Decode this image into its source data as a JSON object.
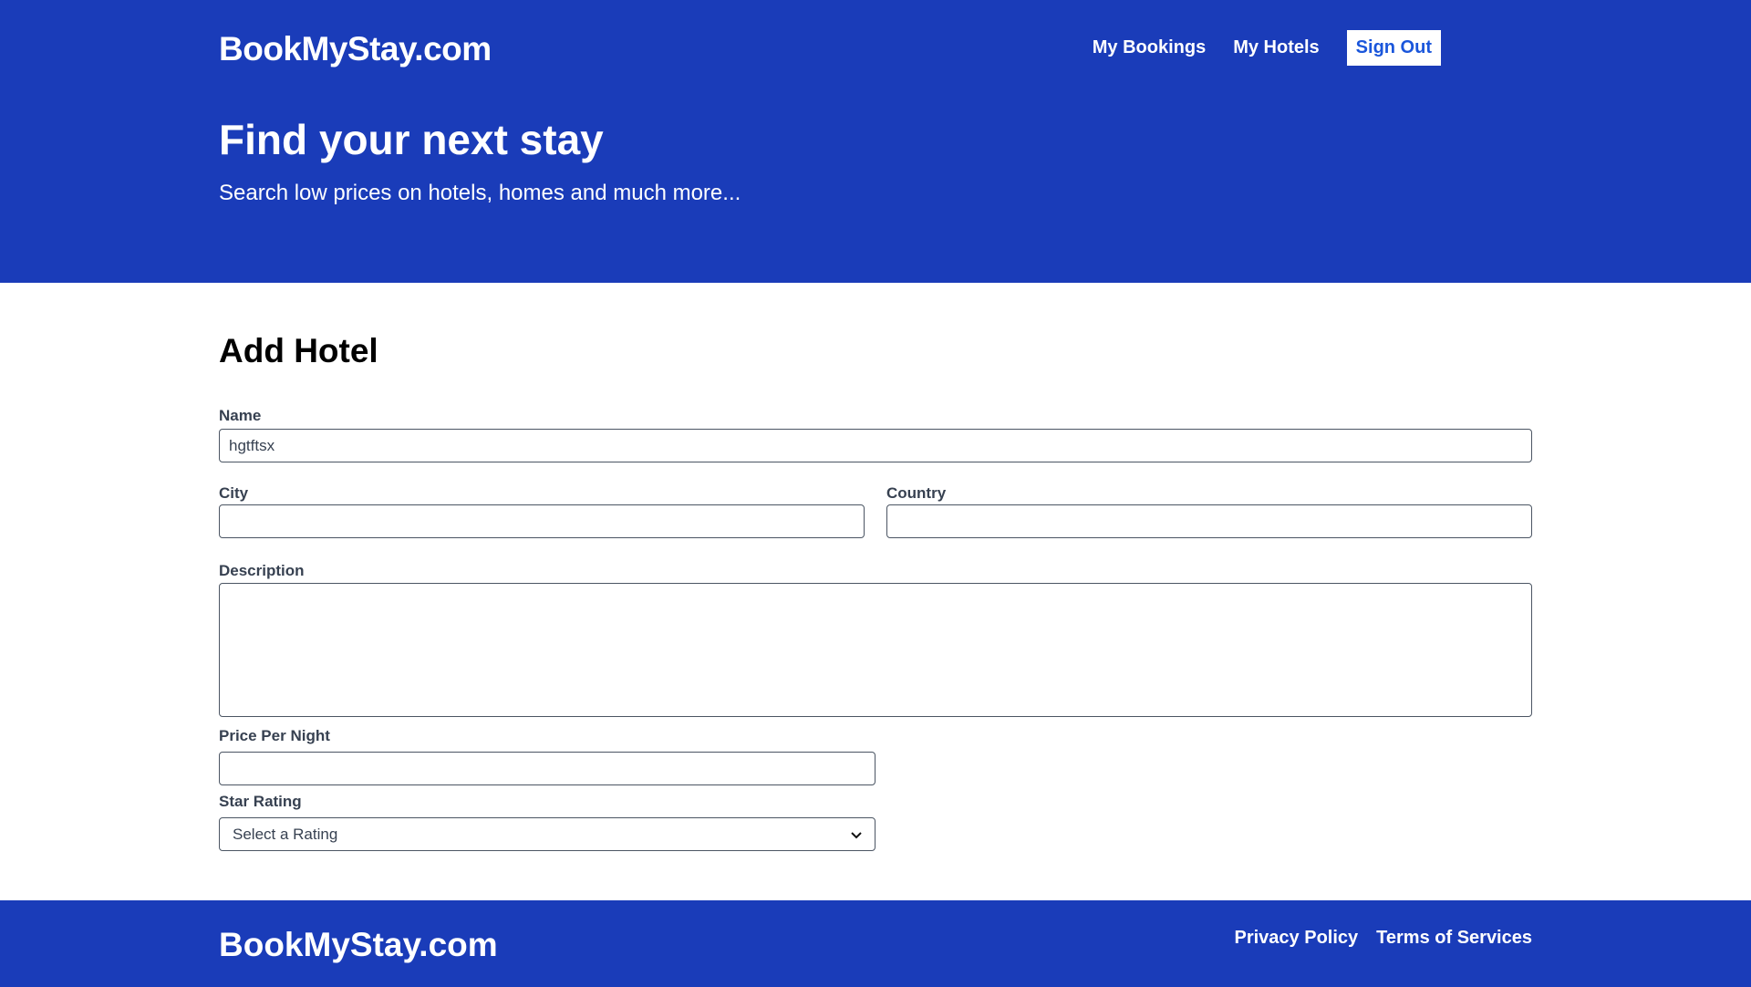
{
  "header": {
    "logo": "BookMyStay.com",
    "nav": {
      "my_bookings": "My Bookings",
      "my_hotels": "My Hotels",
      "sign_out": "Sign Out"
    },
    "hero_title": "Find your next stay",
    "hero_subtitle": "Search low prices on hotels, homes and much more..."
  },
  "form": {
    "title": "Add Hotel",
    "name": {
      "label": "Name",
      "value": "hgtftsx"
    },
    "city": {
      "label": "City",
      "value": ""
    },
    "country": {
      "label": "Country",
      "value": ""
    },
    "description": {
      "label": "Description",
      "value": ""
    },
    "price_per_night": {
      "label": "Price Per Night",
      "value": ""
    },
    "star_rating": {
      "label": "Star Rating",
      "selected": "Select a Rating"
    }
  },
  "footer": {
    "logo": "BookMyStay.com",
    "links": {
      "privacy": "Privacy Policy",
      "terms": "Terms of Services"
    }
  },
  "colors": {
    "brand_blue": "#1a3cb9",
    "sign_out_text": "#1a56db"
  }
}
